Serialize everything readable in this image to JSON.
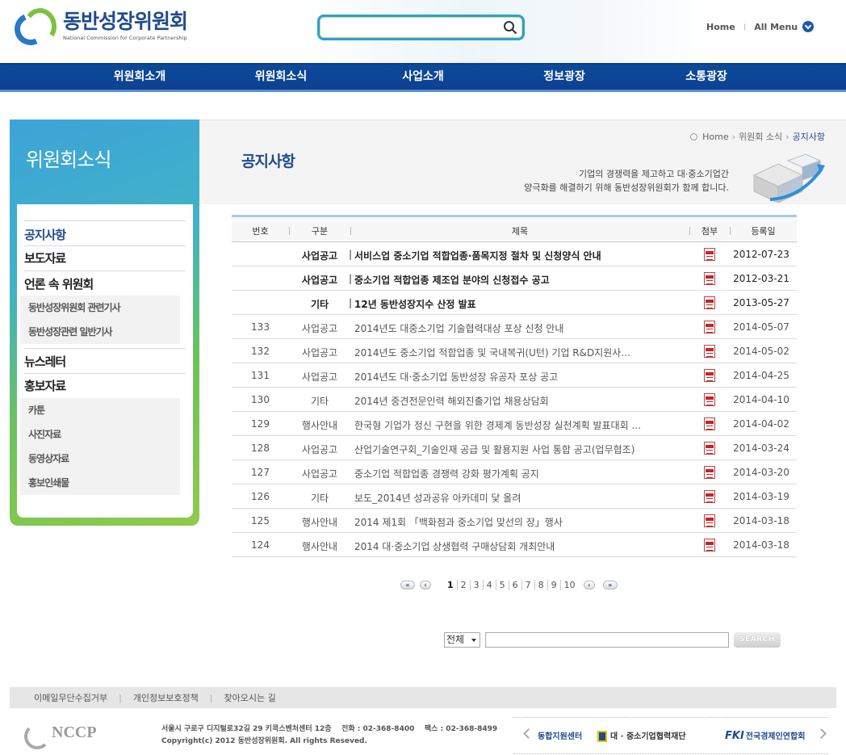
{
  "header": {
    "logo_title": "동반성장위원회",
    "logo_subtitle": "National Commission for Corporate Partnership",
    "search_placeholder": "",
    "home_label": "Home",
    "all_menu_label": "All Menu"
  },
  "gnb": {
    "items": [
      "위원회소개",
      "위원회소식",
      "사업소개",
      "정보광장",
      "소통광장"
    ]
  },
  "lnb": {
    "title": "위원회소식",
    "items": {
      "notice": "공지사항",
      "press": "보도자료",
      "media": "언론 속 위원회",
      "media_sub1": "동반성장위원회 관련기사",
      "media_sub2": "동반성장관련 일반기사",
      "newsletter": "뉴스레터",
      "promo": "홍보자료",
      "promo_sub1": "카툰",
      "promo_sub2": "사진자료",
      "promo_sub3": "동영상자료",
      "promo_sub4": "홍보인쇄물"
    }
  },
  "content": {
    "breadcrumb": [
      "Home",
      "위원회 소식",
      "공지사항"
    ],
    "page_title": "공지사항",
    "slogan_line1": "기업의 경쟁력을 제고하고 대·중소기업간",
    "slogan_line2": "양극화를 해결하기 위해 동반성장위원회가 함께 합니다."
  },
  "board": {
    "columns": {
      "num": "번호",
      "category": "구분",
      "title": "제목",
      "file": "첨부",
      "date": "등록일"
    },
    "notices": [
      {
        "num": "",
        "category": "사업공고",
        "title": "서비스업 중소기업 적합업종·품목지정 절차 및 신청양식 안내",
        "date": "2012-07-23"
      },
      {
        "num": "",
        "category": "사업공고",
        "title": "중소기업 적합업종 제조업 분야의 신청접수 공고",
        "date": "2012-03-21"
      },
      {
        "num": "",
        "category": "기타",
        "title": "12년 동반성장지수 산정 발표",
        "date": "2013-05-27"
      }
    ],
    "rows": [
      {
        "num": "133",
        "category": "사업공고",
        "title": "2014년도 대중소기업 기술협력대상 포상 신청 안내",
        "date": "2014-05-07"
      },
      {
        "num": "132",
        "category": "사업공고",
        "title": "2014년도 중소기업 적합업종 및 국내복귀(U턴) 기업 R&D지원사...",
        "date": "2014-05-02"
      },
      {
        "num": "131",
        "category": "사업공고",
        "title": "2014년도 대·중소기업 동반성장 유공자 포상 공고",
        "date": "2014-04-25"
      },
      {
        "num": "130",
        "category": "기타",
        "title": "2014년 중견전문인력 해외진출기업 채용상담회",
        "date": "2014-04-10"
      },
      {
        "num": "129",
        "category": "행사안내",
        "title": "한국형 기업가 정신 구현을 위한 경제계 동반성장 실천계획 발표대회 ...",
        "date": "2014-04-02"
      },
      {
        "num": "128",
        "category": "사업공고",
        "title": "산업기술연구회_기술인재 공급 및 활용지원 사업 통합 공고(업무협조)",
        "date": "2014-03-24"
      },
      {
        "num": "127",
        "category": "사업공고",
        "title": "중소기업 적합업종 경쟁력 강화 평가계획 공지",
        "date": "2014-03-20"
      },
      {
        "num": "126",
        "category": "기타",
        "title": "보도_2014년 성과공유 아카데미 닻 올려",
        "date": "2014-03-19"
      },
      {
        "num": "125",
        "category": "행사안내",
        "title": "2014 제1회 「백화점과 중소기업 맞선의 장」행사",
        "date": "2014-03-18"
      },
      {
        "num": "124",
        "category": "행사안내",
        "title": "2014 대·중소기업 상생협력 구매상담회 개최안내",
        "date": "2014-03-18"
      }
    ]
  },
  "pager": {
    "first": "«",
    "prev": "‹",
    "next": "›",
    "last": "»",
    "pages": [
      "1",
      "2",
      "3",
      "4",
      "5",
      "6",
      "7",
      "8",
      "9",
      "10"
    ],
    "current": "1"
  },
  "board_search": {
    "select_value": "전체",
    "input_value": "",
    "button_label": "SEARCH"
  },
  "footer": {
    "links": [
      "이메일무단수집거부",
      "개인정보보호정책",
      "찾아오시는 길"
    ],
    "logo_text": "NCCP",
    "address": "서울시 구로구 디지털로32길 29 키콕스벤처센터 12층    전화 : 02-368-8400    팩스 : 02-368-8499",
    "copyright": "Copyright(c) 2012 동반성장위원회. All rights Reseved.",
    "banners": [
      "동합지원센터",
      "대 · 중소기업협력재단",
      "전국경제인연합회"
    ],
    "banner_fki": "FKI"
  },
  "colors": {
    "brand_navy": "#1f4b8f",
    "gnb_blue": "#0a4a9a",
    "search_border": "#2d9fd8",
    "lnb_green": "#8fcb4b"
  }
}
